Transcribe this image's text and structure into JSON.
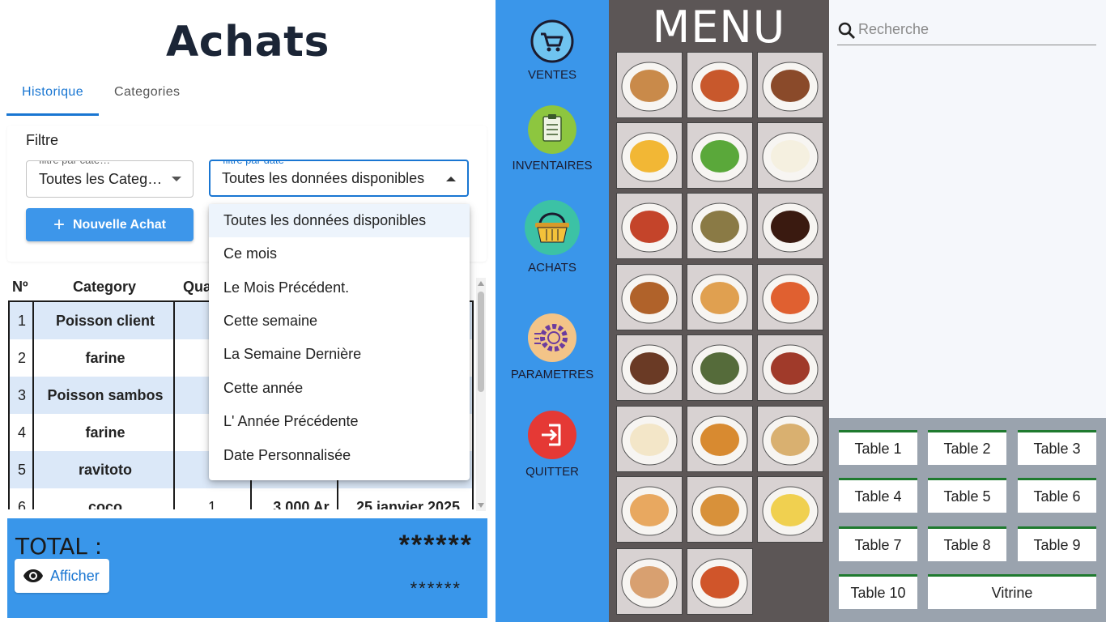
{
  "achats": {
    "title": "Achats",
    "tabs": [
      {
        "label": "Historique",
        "active": true
      },
      {
        "label": "Categories",
        "active": false
      }
    ],
    "filter": {
      "label": "Filtre",
      "category_select": {
        "legend": "filtre par cate…",
        "value": "Toutes les Categ…"
      },
      "date_select": {
        "legend": "filtre par date",
        "value": "Toutes les données disponibles"
      }
    },
    "new_button": "Nouvelle Achat",
    "table": {
      "headers": [
        "Nº",
        "Category",
        "Qua"
      ],
      "rows": [
        {
          "n": "1",
          "category": "Poisson client",
          "qty": "",
          "price": "",
          "date": ""
        },
        {
          "n": "2",
          "category": "farine",
          "qty": "",
          "price": "",
          "date": ""
        },
        {
          "n": "3",
          "category": "Poisson sambos",
          "qty": "",
          "price": "",
          "date": ""
        },
        {
          "n": "4",
          "category": "farine",
          "qty": "",
          "price": "",
          "date": ""
        },
        {
          "n": "5",
          "category": "ravitoto",
          "qty": "",
          "price": "",
          "date": ""
        },
        {
          "n": "6",
          "category": "coco",
          "qty": "1",
          "price": "3.000 Ar",
          "date": "25 janvier 2025"
        }
      ]
    },
    "dropdown": [
      "Toutes les données disponibles",
      "Ce mois",
      "Le Mois Précédent.",
      "Cette semaine",
      "La Semaine Dernière",
      "Cette année",
      "L' Année Précédente",
      "Date Personnalisée"
    ],
    "total": {
      "label": "TOTAL :",
      "value_big": "******",
      "value_small": "******",
      "afficher": "Afficher"
    }
  },
  "nav": [
    {
      "label": "VENTES",
      "icon": "cart-icon"
    },
    {
      "label": "INVENTAIRES",
      "icon": "clipboard-icon"
    },
    {
      "label": "ACHATS",
      "icon": "basket-icon"
    },
    {
      "label": "PARAMETRES",
      "icon": "gear-icon"
    },
    {
      "label": "QUITTER",
      "icon": "exit-icon"
    }
  ],
  "menu": {
    "title": "MENU",
    "dishes": [
      "soup",
      "spaghetti",
      "steak-frites",
      "fries",
      "salad",
      "rice-egg",
      "spaghetti-meatballs",
      "fried-rice",
      "cola",
      "roast-chicken",
      "calamari",
      "shrimp",
      "grilled-beef",
      "grilled-fish",
      "sliced-beef",
      "fried-eggs",
      "burger",
      "wrap",
      "samosas",
      "croissant",
      "yogurt",
      "panini",
      "pizza"
    ]
  },
  "right": {
    "search_placeholder": "Recherche",
    "tables": [
      "Table 1",
      "Table 2",
      "Table 3",
      "Table 4",
      "Table 5",
      "Table 6",
      "Table 7",
      "Table 8",
      "Table 9",
      "Table 10",
      "Vitrine"
    ]
  },
  "colors": {
    "accent": "#3a96ea",
    "primary": "#1976d2",
    "menu_bg": "#5c5656",
    "table_border": "#1f7a2f"
  }
}
